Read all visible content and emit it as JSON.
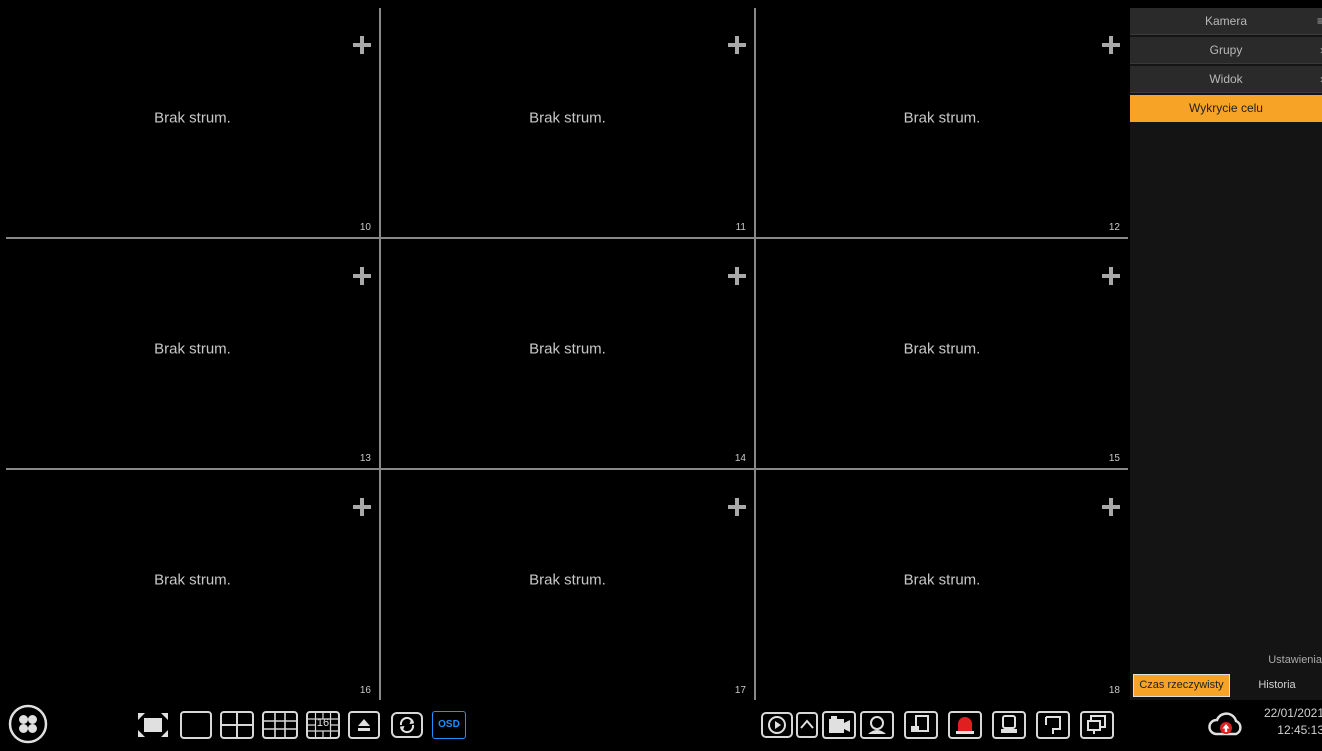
{
  "tiles": [
    {
      "message": "Brak strum.",
      "number": "10"
    },
    {
      "message": "Brak strum.",
      "number": "11"
    },
    {
      "message": "Brak strum.",
      "number": "12"
    },
    {
      "message": "Brak strum.",
      "number": "13"
    },
    {
      "message": "Brak strum.",
      "number": "14"
    },
    {
      "message": "Brak strum.",
      "number": "15"
    },
    {
      "message": "Brak strum.",
      "number": "16"
    },
    {
      "message": "Brak strum.",
      "number": "17"
    },
    {
      "message": "Brak strum.",
      "number": "18"
    }
  ],
  "sidebar": {
    "sections": [
      "Kamera",
      "Grupy",
      "Widok"
    ],
    "active_item": "Wykrycie celu",
    "settings_label": "Ustawienia",
    "tabs": {
      "live": "Czas rzeczywisty",
      "history": "Historia"
    }
  },
  "toolbar": {
    "osd_label": "OSD",
    "layout_16_label": "16",
    "date": "22/01/2021",
    "time": "12:45:13"
  },
  "icons": {
    "menu": "start-menu-icon",
    "fullscreen": "fullscreen-icon",
    "layouts": [
      "layout-1-icon",
      "layout-4-icon",
      "layout-9-icon",
      "layout-16-icon",
      "layout-custom-icon"
    ],
    "right_group": [
      "playback-icon",
      "expand-up-icon",
      "record-icon",
      "face-icon",
      "snapshot-icon",
      "alarm-icon",
      "person-icon",
      "output-icon",
      "display-icon"
    ],
    "cloud": "cloud-upload-icon"
  },
  "colors": {
    "accent": "#f7a325",
    "osd": "#1e90ff",
    "alarm": "#e02020"
  }
}
